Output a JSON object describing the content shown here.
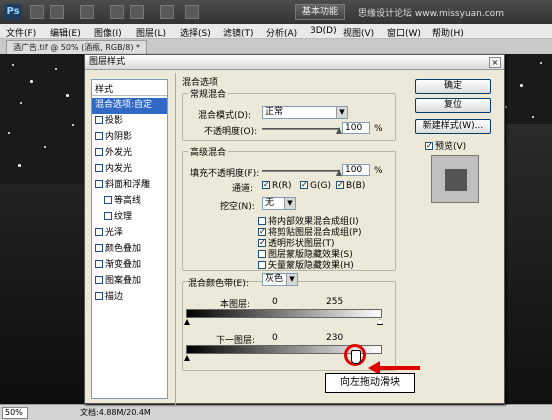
{
  "app": {
    "logo": "Ps",
    "workspace_button": "基本功能",
    "watermark": "思缘设计论坛 www.missyuan.com"
  },
  "menu": [
    "文件(F)",
    "编辑(E)",
    "图像(I)",
    "图层(L)",
    "选择(S)",
    "滤镜(T)",
    "分析(A)",
    "3D(D)",
    "视图(V)",
    "窗口(W)",
    "帮助(H)"
  ],
  "document_tab": "酒广告.tif @ 50% (酒瓶, RGB/8) *",
  "status": {
    "zoom": "50%",
    "doc_size": "文档:4.88M/20.4M"
  },
  "dialog": {
    "title": "图层样式",
    "close_glyph": "×",
    "left_panel": {
      "header": "样式",
      "items": [
        {
          "label": "混合选项:自定",
          "checkbox": false,
          "selected": true,
          "indent": false
        },
        {
          "label": "投影",
          "checkbox": true,
          "selected": false,
          "indent": false
        },
        {
          "label": "内阴影",
          "checkbox": true,
          "selected": false,
          "indent": false
        },
        {
          "label": "外发光",
          "checkbox": true,
          "selected": false,
          "indent": false
        },
        {
          "label": "内发光",
          "checkbox": true,
          "selected": false,
          "indent": false
        },
        {
          "label": "斜面和浮雕",
          "checkbox": true,
          "selected": false,
          "indent": false
        },
        {
          "label": "等高线",
          "checkbox": true,
          "selected": false,
          "indent": true
        },
        {
          "label": "纹理",
          "checkbox": true,
          "selected": false,
          "indent": true
        },
        {
          "label": "光泽",
          "checkbox": true,
          "selected": false,
          "indent": false
        },
        {
          "label": "颜色叠加",
          "checkbox": true,
          "selected": false,
          "indent": false
        },
        {
          "label": "渐变叠加",
          "checkbox": true,
          "selected": false,
          "indent": false
        },
        {
          "label": "图案叠加",
          "checkbox": true,
          "selected": false,
          "indent": false
        },
        {
          "label": "描边",
          "checkbox": true,
          "selected": false,
          "indent": false
        }
      ]
    },
    "blend": {
      "section_title": "混合选项",
      "general": {
        "title": "常规混合",
        "mode_label": "混合模式(D):",
        "mode_value": "正常",
        "opacity_label": "不透明度(O):",
        "opacity_value": "100",
        "opacity_unit": "%"
      },
      "advanced": {
        "title": "高级混合",
        "fill_label": "填充不透明度(F):",
        "fill_value": "100",
        "fill_unit": "%",
        "channels_label": "通道:",
        "channels": [
          {
            "label": "R(R)",
            "checked": true
          },
          {
            "label": "G(G)",
            "checked": true
          },
          {
            "label": "B(B)",
            "checked": true
          }
        ],
        "knockout_label": "挖空(N):",
        "knockout_value": "无",
        "options": [
          {
            "label": "将内部效果混合成组(I)",
            "checked": false
          },
          {
            "label": "将剪贴图层混合成组(P)",
            "checked": true
          },
          {
            "label": "透明形状图层(T)",
            "checked": true
          },
          {
            "label": "图层蒙版隐藏效果(S)",
            "checked": false
          },
          {
            "label": "矢量蒙版隐藏效果(H)",
            "checked": false
          }
        ]
      },
      "blend_if": {
        "label": "混合颜色带(E):",
        "value": "灰色",
        "this_layer_label": "本图层:",
        "this_layer_low": "0",
        "this_layer_high": "255",
        "underlying_label": "下一图层:",
        "underlying_low": "0",
        "underlying_high": "230"
      }
    },
    "buttons": {
      "ok": "确定",
      "reset": "复位",
      "new_style": "新建样式(W)...",
      "preview_label": "预览(V)",
      "preview_checked": true
    }
  },
  "annotation": {
    "callout": "向左拖动滑块"
  }
}
